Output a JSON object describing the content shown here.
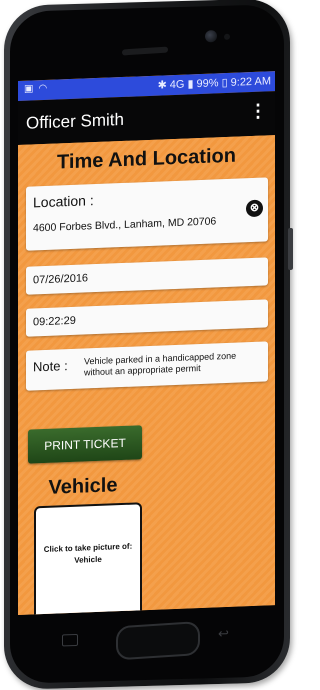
{
  "status_bar": {
    "left_icons": [
      "image-icon",
      "wifi-icon"
    ],
    "right_icons": [
      "bluetooth-icon",
      "signal-icon"
    ],
    "network": "4G",
    "battery": "99%",
    "time": "9:22 AM",
    "color": "#2d4bdb"
  },
  "app_bar": {
    "title": "Officer Smith",
    "menu_icon": "⋮"
  },
  "form": {
    "section_title": "Time And Location",
    "location": {
      "label": "Location :",
      "value": "4600 Forbes Blvd., Lanham, MD 20706",
      "clear_icon": "⊗"
    },
    "date": "07/26/2016",
    "time": "09:22:29",
    "note": {
      "label": "Note :",
      "value": "Vehicle parked in a handicapped zone without an appropriate permit"
    },
    "print_button": "PRINT TICKET",
    "vehicle": {
      "section_title": "Vehicle",
      "photo_prompt": "Click to take picture of:",
      "photo_subject": "Vehicle"
    }
  },
  "colors": {
    "background": "#f5a04a",
    "app_bar": "#070708",
    "button": "#2d5a22"
  }
}
